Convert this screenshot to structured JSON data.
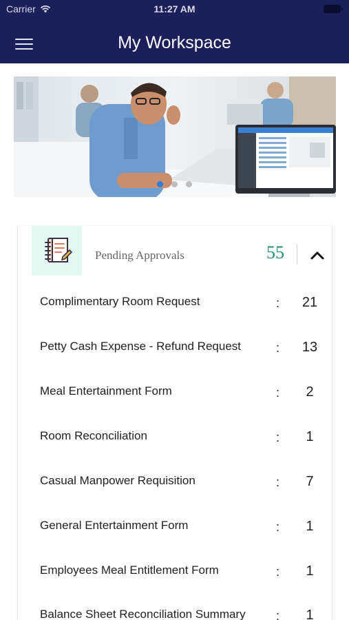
{
  "status_bar": {
    "carrier": "Carrier",
    "time": "11:27 AM"
  },
  "header": {
    "title": "My Workspace"
  },
  "icons": {
    "menu": "hamburger-menu-icon",
    "wifi": "wifi-icon",
    "battery": "battery-icon",
    "approvals": "notebook-checklist-icon",
    "collapse": "chevron-up-icon"
  },
  "colors": {
    "header_bg": "#1b1f5a",
    "accent": "#1e8f75",
    "icon_bg": "#e3f8f1",
    "dot_active": "#2f7de1"
  },
  "carousel": {
    "slide_count": 3,
    "active_index": 0
  },
  "pending": {
    "label": "Pending Approvals",
    "total": "55",
    "items": [
      {
        "label": "Complimentary Room Request",
        "sep": ":",
        "count": "21"
      },
      {
        "label": "Petty Cash Expense - Refund Request",
        "sep": ":",
        "count": "13"
      },
      {
        "label": "Meal Entertainment Form",
        "sep": ":",
        "count": "2"
      },
      {
        "label": "Room Reconciliation",
        "sep": ":",
        "count": "1"
      },
      {
        "label": "Casual Manpower Requisition",
        "sep": ":",
        "count": "7"
      },
      {
        "label": "General Entertainment Form",
        "sep": ":",
        "count": "1"
      },
      {
        "label": "Employees Meal Entitlement Form",
        "sep": ":",
        "count": "1"
      },
      {
        "label": "Balance Sheet Reconciliation Summary",
        "sep": ":",
        "count": "1"
      }
    ]
  }
}
